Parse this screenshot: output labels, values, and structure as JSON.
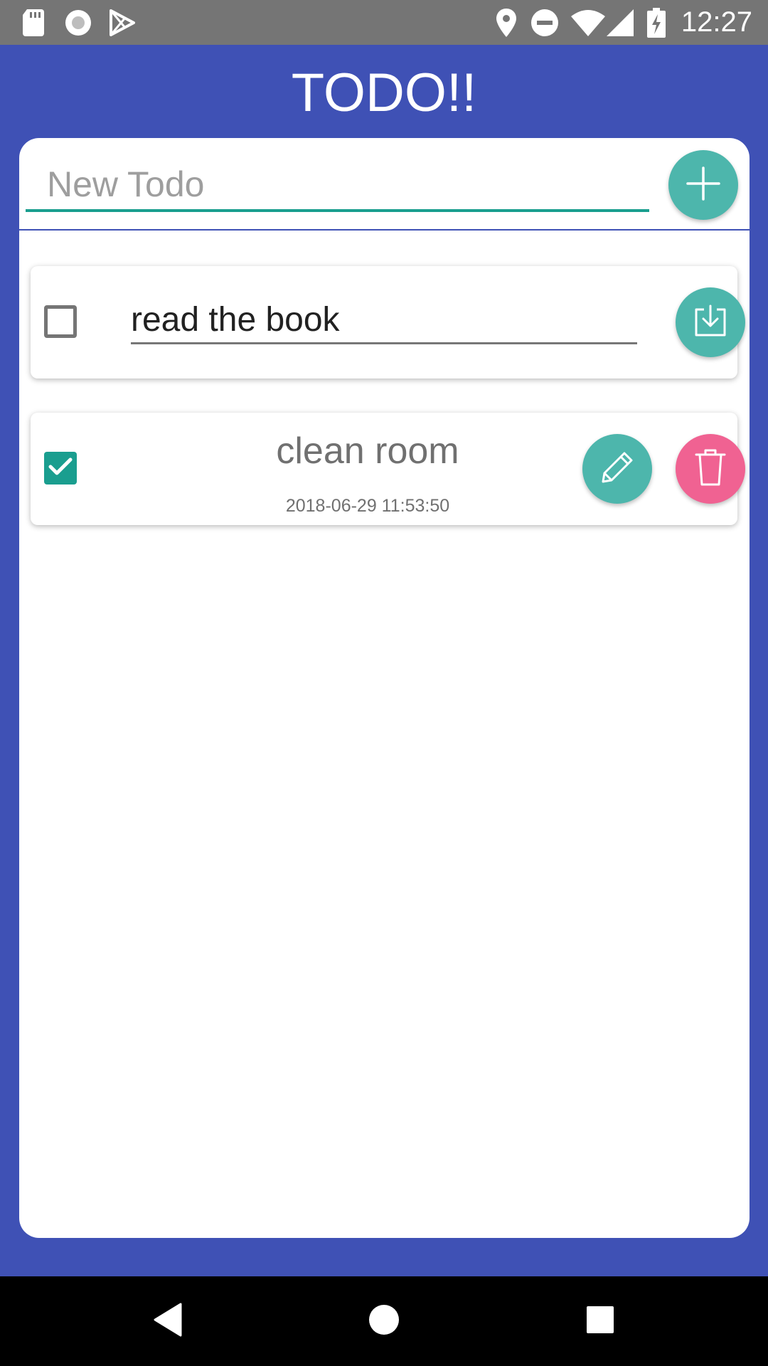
{
  "status_bar": {
    "time": "12:27",
    "left_icons": [
      "sd-card-icon",
      "record-icon",
      "play-store-icon"
    ],
    "right_icons": [
      "location-icon",
      "do-not-disturb-icon",
      "wifi-icon",
      "signal-icon",
      "battery-charging-icon"
    ]
  },
  "app": {
    "title": "TODO!!"
  },
  "new_todo": {
    "placeholder": "New Todo",
    "value": "",
    "add_icon": "plus-icon"
  },
  "todos": [
    {
      "checked": false,
      "editing": true,
      "text": "read the book",
      "action_icon": "save-download-icon"
    },
    {
      "checked": true,
      "editing": false,
      "title": "clean room",
      "timestamp": "2018-06-29 11:53:50",
      "action_icons": [
        "pencil-icon",
        "trash-icon"
      ]
    }
  ],
  "nav_bar": {
    "icons": [
      "back-icon",
      "home-icon",
      "recents-icon"
    ]
  },
  "colors": {
    "primary": "#3f51b5",
    "accent_teal": "#4db6ac",
    "checkbox_teal": "#1a9e8f",
    "delete_pink": "#f06292",
    "status_bar": "#757575"
  }
}
